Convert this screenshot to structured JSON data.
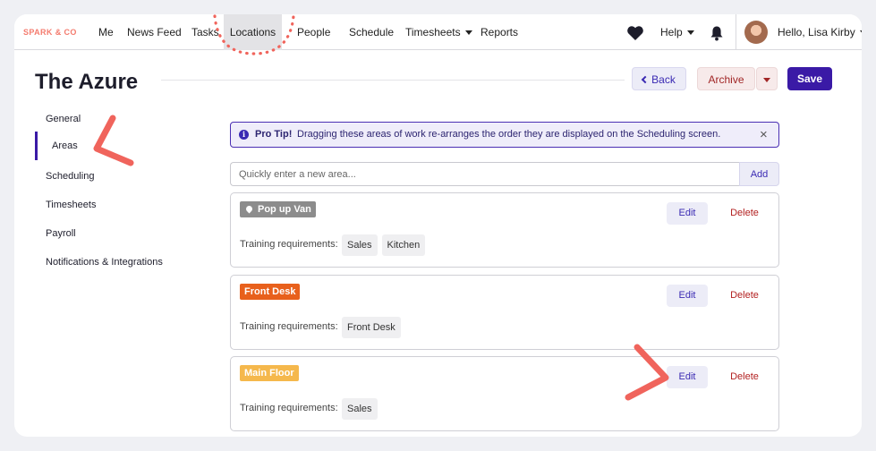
{
  "nav": {
    "brand": "SPARK & CO",
    "items": [
      {
        "label": "Me"
      },
      {
        "label": "News Feed"
      },
      {
        "label": "Tasks"
      },
      {
        "label": "Locations"
      },
      {
        "label": "People"
      },
      {
        "label": "Schedule"
      },
      {
        "label": "Timesheets"
      },
      {
        "label": "Reports"
      }
    ],
    "help_label": "Help",
    "user_label": "Hello, Lisa Kirby",
    "active_item": "Locations"
  },
  "header": {
    "title": "The Azure",
    "back_label": "Back",
    "archive_label": "Archive",
    "save_label": "Save"
  },
  "sidebar": {
    "items": [
      {
        "label": "General"
      },
      {
        "label": "Areas"
      },
      {
        "label": "Scheduling"
      },
      {
        "label": "Timesheets"
      },
      {
        "label": "Payroll"
      },
      {
        "label": "Notifications & Integrations"
      }
    ],
    "active_item": "Areas"
  },
  "protip": {
    "label": "Pro Tip!",
    "text": "Dragging these areas of work re-arranges the order they are displayed on the Scheduling screen."
  },
  "new_area": {
    "placeholder": "Quickly enter a new area...",
    "add_label": "Add"
  },
  "areas": [
    {
      "name": "Pop up Van",
      "color": "#8c8c8c",
      "icon": "map-pin-icon",
      "edit_label": "Edit",
      "delete_label": "Delete",
      "training_label": "Training requirements:",
      "requirements": [
        "Sales",
        "Kitchen"
      ]
    },
    {
      "name": "Front Desk",
      "color": "#e8601c",
      "edit_label": "Edit",
      "delete_label": "Delete",
      "training_label": "Training requirements:",
      "requirements": [
        "Front Desk"
      ]
    },
    {
      "name": "Main Floor",
      "color": "#f5b84c",
      "edit_label": "Edit",
      "delete_label": "Delete",
      "training_label": "Training requirements:",
      "requirements": [
        "Sales"
      ]
    }
  ],
  "colors": {
    "accent": "#3a1aa6",
    "annotation": "#f0645c",
    "delete": "#b21f1f"
  }
}
